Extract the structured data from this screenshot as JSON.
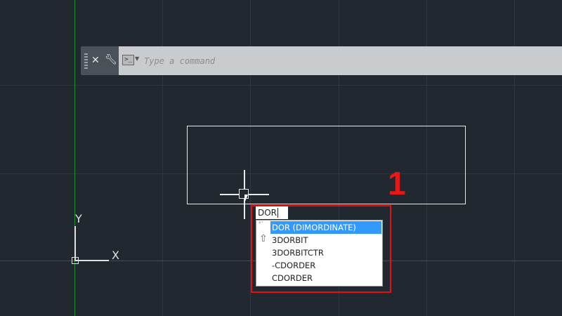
{
  "command_line": {
    "placeholder": "Type a command",
    "close_icon": "close-icon",
    "settings_icon": "wrench-icon",
    "prompt_icon": "command-prompt-icon"
  },
  "autocomplete": {
    "typed_text": "DOR",
    "items": [
      {
        "label": "DOR (DIMORDINATE)",
        "selected": true
      },
      {
        "label": "3DORBIT",
        "selected": false
      },
      {
        "label": "3DORBITCTR",
        "selected": false
      },
      {
        "label": "-CDORDER",
        "selected": false
      },
      {
        "label": "CDORDER",
        "selected": false
      }
    ]
  },
  "annotation": {
    "step_number": "1",
    "color": "#e81010"
  },
  "ucs": {
    "x_label": "X",
    "y_label": "Y"
  },
  "colors": {
    "background": "#212830",
    "x_axis": "#b02020",
    "y_axis": "#1f8a2a",
    "highlight": "#3399ff"
  }
}
